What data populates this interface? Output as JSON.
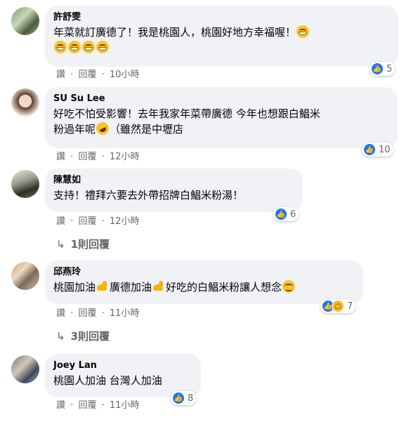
{
  "comments": [
    {
      "author": "許舒雯",
      "text_lines": [
        "年菜就訂廣德了！我是桃園人，桃園好地方幸福喔！",
        ""
      ],
      "emoji_inline": "grinning-emoji",
      "emoji_row": [
        "grinning-emoji",
        "grinning-emoji",
        "grinning-emoji",
        "grinning-emoji"
      ],
      "reaction_count": "5",
      "actions": {
        "like": "讚",
        "reply": "回覆",
        "time": "10小時"
      }
    },
    {
      "author": "SU Su Lee",
      "text_line1": "好吃不怕受影響！去年我家年菜帶廣德 今年也想跟白鯧米",
      "text_line2a": "粉過年呢",
      "text_line2b": "（雖然是中壢店",
      "reaction_count": "10",
      "actions": {
        "like": "讚",
        "reply": "回覆",
        "time": "12小時"
      }
    },
    {
      "author": "陳慧如",
      "text": "支持！禮拜六要去外帶招牌白鯧米粉湯！",
      "reaction_count": "6",
      "actions": {
        "like": "讚",
        "reply": "回覆",
        "time": "12小時"
      },
      "replies": "1則回覆"
    },
    {
      "author": "邱燕玲",
      "text_a": "桃園加油",
      "text_b": "廣德加油",
      "text_c": "好吃的白鯧米粉讓人想念",
      "reaction_count": "7",
      "actions": {
        "like": "讚",
        "reply": "回覆",
        "time": "11小時"
      },
      "replies": "3則回覆"
    },
    {
      "author": "Joey Lan",
      "text": "桃園人加油 台灣人加油",
      "reaction_count": "8",
      "actions": {
        "like": "讚",
        "reply": "回覆",
        "time": "11小時"
      }
    }
  ],
  "separator": "·",
  "colors": {
    "bubble": "#f0f2f5",
    "like_blue": "#1877f2",
    "meta_gray": "#65676b"
  }
}
